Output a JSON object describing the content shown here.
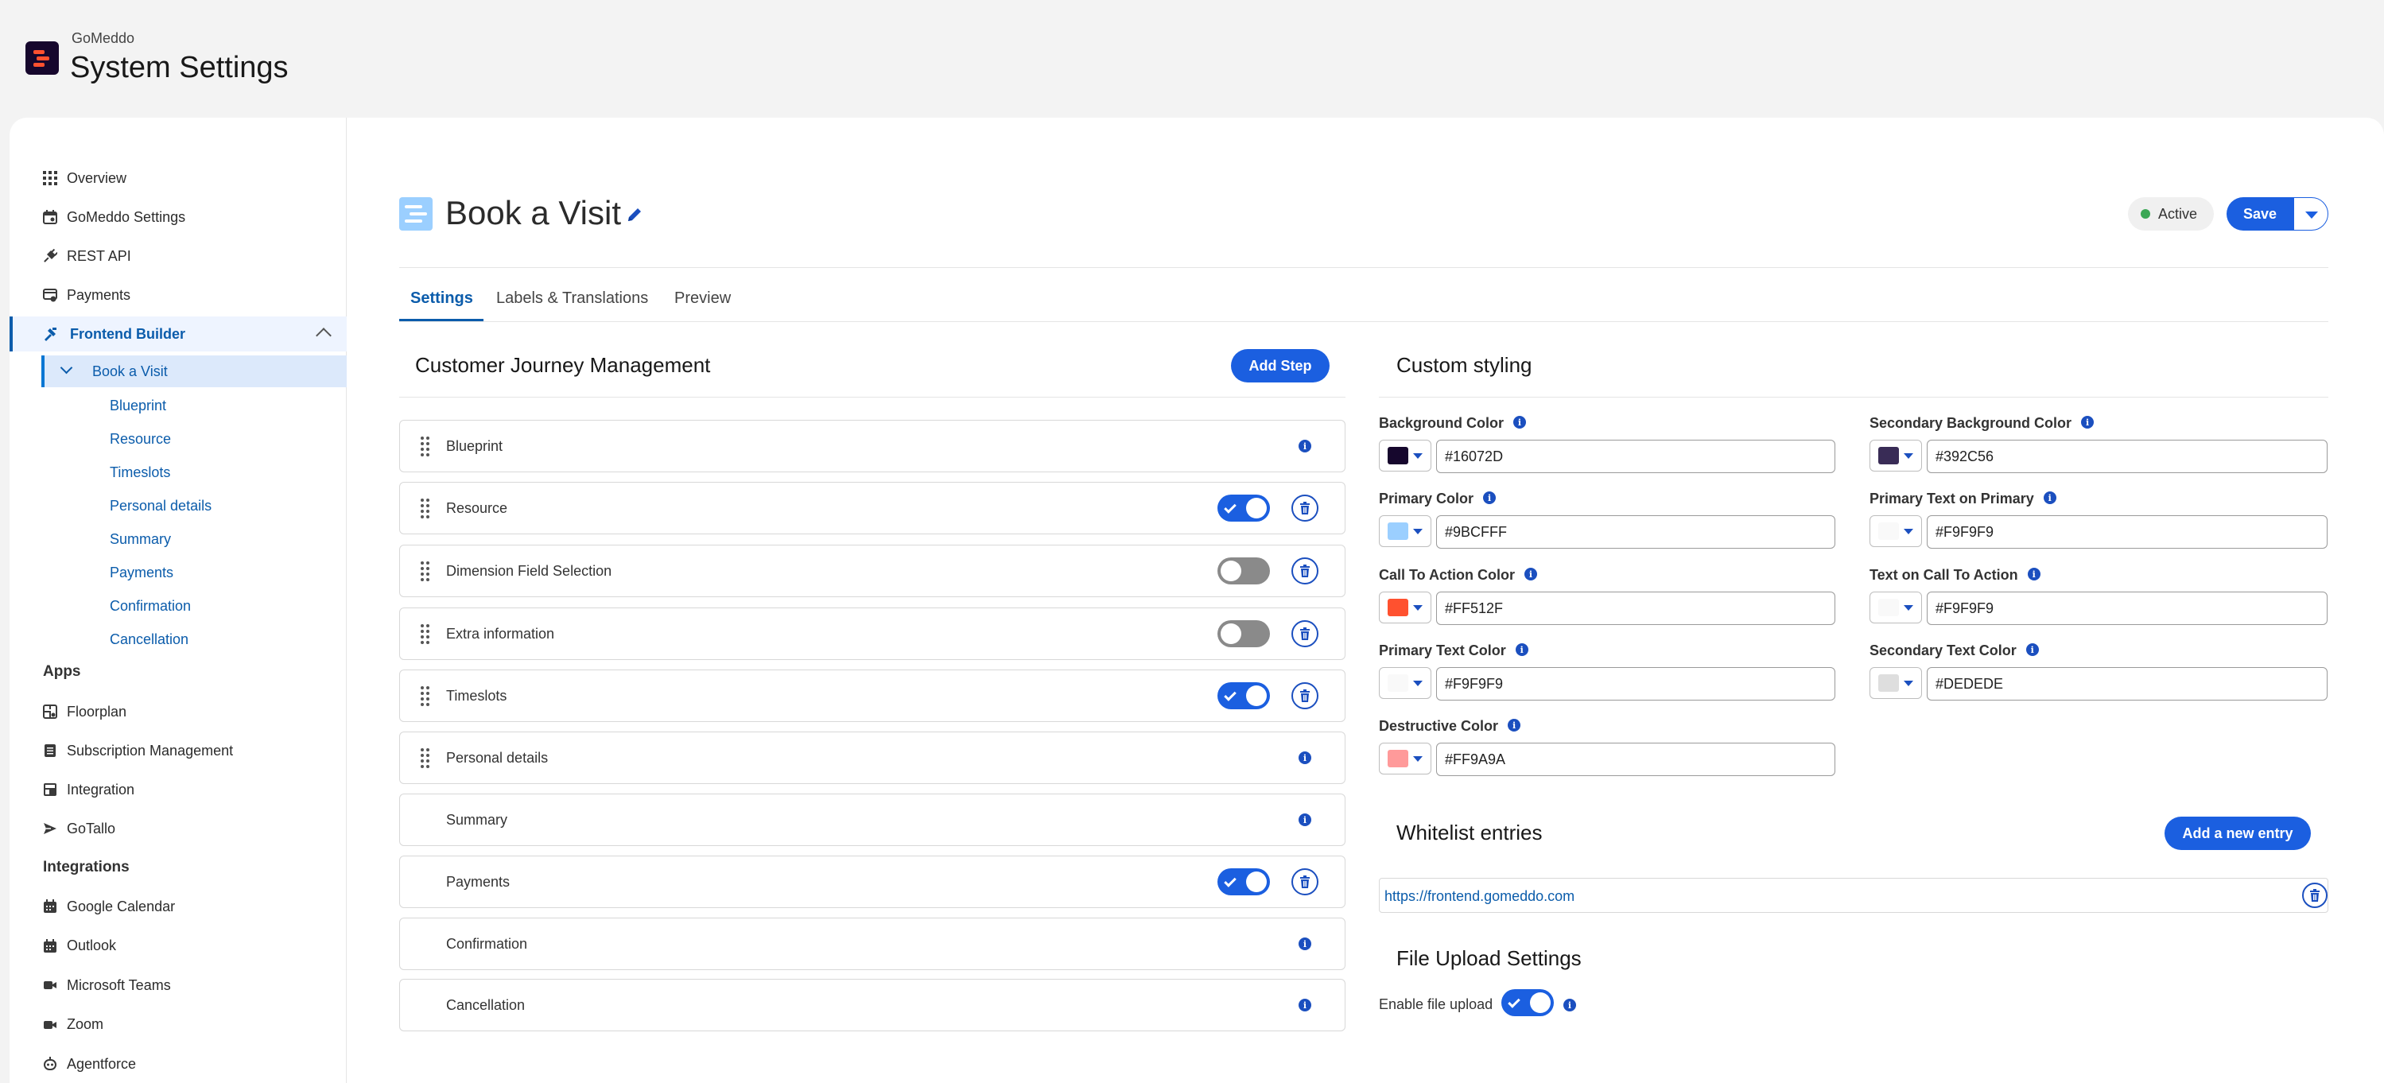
{
  "header": {
    "app_name": "GoMeddo",
    "title": "System Settings"
  },
  "sidebar": {
    "main_items": [
      {
        "label": "Overview",
        "icon": "grid-icon"
      },
      {
        "label": "GoMeddo Settings",
        "icon": "calendar-settings-icon"
      },
      {
        "label": "REST API",
        "icon": "plug-icon"
      },
      {
        "label": "Payments",
        "icon": "payment-icon"
      },
      {
        "label": "Frontend Builder",
        "icon": "builder-icon"
      }
    ],
    "sub_item": "Book a Visit",
    "sub_links": [
      "Blueprint",
      "Resource",
      "Timeslots",
      "Personal details",
      "Summary",
      "Payments",
      "Confirmation",
      "Cancellation"
    ],
    "apps_heading": "Apps",
    "apps": [
      {
        "label": "Floorplan",
        "icon": "floorplan-icon"
      },
      {
        "label": "Subscription Management",
        "icon": "list-icon"
      },
      {
        "label": "Integration",
        "icon": "integration-icon"
      },
      {
        "label": "GoTallo",
        "icon": "send-icon"
      }
    ],
    "integrations_heading": "Integrations",
    "integrations": [
      {
        "label": "Google Calendar",
        "icon": "calendar-icon"
      },
      {
        "label": "Outlook",
        "icon": "calendar-icon"
      },
      {
        "label": "Microsoft Teams",
        "icon": "video-icon"
      },
      {
        "label": "Zoom",
        "icon": "video-icon"
      },
      {
        "label": "Agentforce",
        "icon": "bot-icon"
      }
    ]
  },
  "page": {
    "title": "Book a Visit",
    "status": "Active",
    "save_label": "Save",
    "tabs": [
      "Settings",
      "Labels & Translations",
      "Preview"
    ]
  },
  "journey": {
    "title": "Customer Journey Management",
    "add_step_label": "Add Step",
    "steps": [
      {
        "name": "Blueprint",
        "draggable": true,
        "control": "info"
      },
      {
        "name": "Resource",
        "draggable": true,
        "control": "toggle",
        "enabled": true
      },
      {
        "name": "Dimension Field Selection",
        "draggable": true,
        "control": "toggle",
        "enabled": false
      },
      {
        "name": "Extra information",
        "draggable": true,
        "control": "toggle",
        "enabled": false
      },
      {
        "name": "Timeslots",
        "draggable": true,
        "control": "toggle",
        "enabled": true
      },
      {
        "name": "Personal details",
        "draggable": true,
        "control": "info"
      },
      {
        "name": "Summary",
        "draggable": false,
        "control": "info"
      },
      {
        "name": "Payments",
        "draggable": false,
        "control": "toggle",
        "enabled": true
      },
      {
        "name": "Confirmation",
        "draggable": false,
        "control": "info"
      },
      {
        "name": "Cancellation",
        "draggable": false,
        "control": "info"
      }
    ]
  },
  "styling": {
    "title": "Custom styling",
    "fields": [
      {
        "label": "Background Color",
        "value": "#16072D",
        "swatch": "#16072D"
      },
      {
        "label": "Secondary Background Color",
        "value": "#392C56",
        "swatch": "#392C56"
      },
      {
        "label": "Primary Color",
        "value": "#9BCFFF",
        "swatch": "#9BCFFF"
      },
      {
        "label": "Primary Text on Primary",
        "value": "#F9F9F9",
        "swatch": "#F9F9F9"
      },
      {
        "label": "Call To Action Color",
        "value": "#FF512F",
        "swatch": "#FF512F"
      },
      {
        "label": "Text on Call To Action",
        "value": "#F9F9F9",
        "swatch": "#F9F9F9"
      },
      {
        "label": "Primary Text Color",
        "value": "#F9F9F9",
        "swatch": "#F9F9F9"
      },
      {
        "label": "Secondary Text Color",
        "value": "#DEDEDE",
        "swatch": "#DEDEDE"
      },
      {
        "label": "Destructive Color",
        "value": "#FF9A9A",
        "swatch": "#FF9A9A"
      }
    ]
  },
  "whitelist": {
    "title": "Whitelist entries",
    "add_label": "Add a new entry",
    "entries": [
      "https://frontend.gomeddo.com"
    ]
  },
  "file_upload": {
    "title": "File Upload Settings",
    "label": "Enable file upload",
    "enabled": true
  },
  "colors": {
    "accent": "#1b5fe0",
    "link": "#0b5cab"
  }
}
